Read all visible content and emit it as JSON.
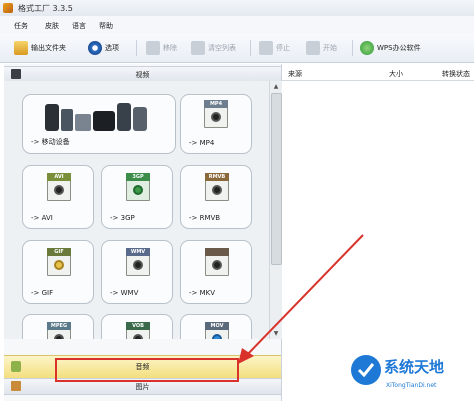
{
  "window": {
    "title": "格式工厂 3.3.5"
  },
  "menu": [
    "任务",
    "皮肤",
    "语言",
    "帮助"
  ],
  "toolbar": {
    "output_folder": "输出文件夹",
    "options": "选项",
    "remove": "移除",
    "clear_list": "清空列表",
    "stop": "停止",
    "start": "开始",
    "wps": "WPS办公软件"
  },
  "categories": {
    "video": "视频",
    "audio": "音频",
    "image": "图片"
  },
  "tiles": [
    {
      "label": "-> 移动设备",
      "icon": "mobile-devices-icon"
    },
    {
      "label": "-> MP4",
      "icon": "mp4-file-icon",
      "tag": "MP4"
    },
    {
      "label": "-> AVI",
      "icon": "avi-file-icon",
      "tag": "AVI"
    },
    {
      "label": "-> 3GP",
      "icon": "3gp-file-icon",
      "tag": "3GP"
    },
    {
      "label": "-> RMVB",
      "icon": "rmvb-file-icon",
      "tag": "RMVB"
    },
    {
      "label": "-> GIF",
      "icon": "gif-file-icon",
      "tag": "GIF"
    },
    {
      "label": "-> WMV",
      "icon": "wmv-file-icon",
      "tag": "WMV"
    },
    {
      "label": "-> MKV",
      "icon": "mkv-file-icon",
      "tag": ""
    },
    {
      "label": "",
      "icon": "mpeg-file-icon",
      "tag": "MPEG"
    },
    {
      "label": "",
      "icon": "vob-file-icon",
      "tag": "VOB"
    },
    {
      "label": "",
      "icon": "mov-file-icon",
      "tag": "MOV"
    }
  ],
  "list_headers": {
    "source": "来源",
    "size": "大小",
    "status": "转换状态"
  },
  "watermark": {
    "main": "系统天地",
    "sub": "XiTongTianDi.net"
  },
  "colors": {
    "accent": "#1e78d6",
    "highlight": "#f3df7e",
    "annotation": "#d8322a"
  }
}
